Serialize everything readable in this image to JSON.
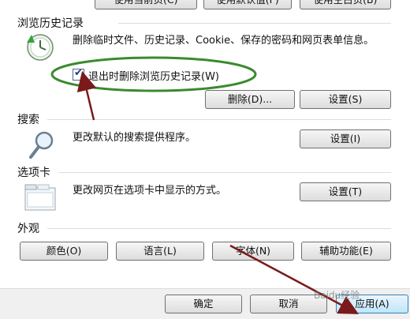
{
  "top_buttons": [
    {
      "label": "使用当前页(C)"
    },
    {
      "label": "使用默认值(F)"
    },
    {
      "label": "使用空白页(B)"
    }
  ],
  "history": {
    "title": "浏览历史记录",
    "description": "删除临时文件、历史记录、Cookie、保存的密码和网页表单信息。",
    "checkbox_label": "退出时删除浏览历史记录(W)",
    "checkbox_checked": true,
    "delete_label": "删除(D)...",
    "settings_label": "设置(S)"
  },
  "search": {
    "title": "搜索",
    "description": "更改默认的搜索提供程序。",
    "settings_label": "设置(I)"
  },
  "tabs": {
    "title": "选项卡",
    "description": "更改网页在选项卡中显示的方式。",
    "settings_label": "设置(T)"
  },
  "appearance": {
    "title": "外观",
    "buttons": [
      "颜色(O)",
      "语言(L)",
      "字体(N)",
      "辅助功能(E)"
    ]
  },
  "footer": {
    "ok_label": "确定",
    "cancel_label": "取消",
    "apply_label": "应用(A)"
  },
  "watermark": "Baidu经验",
  "colors": {
    "annotation_ellipse": "#3a8a2e",
    "annotation_arrow": "#7a1a1a",
    "accent": "#3c7fb1"
  }
}
